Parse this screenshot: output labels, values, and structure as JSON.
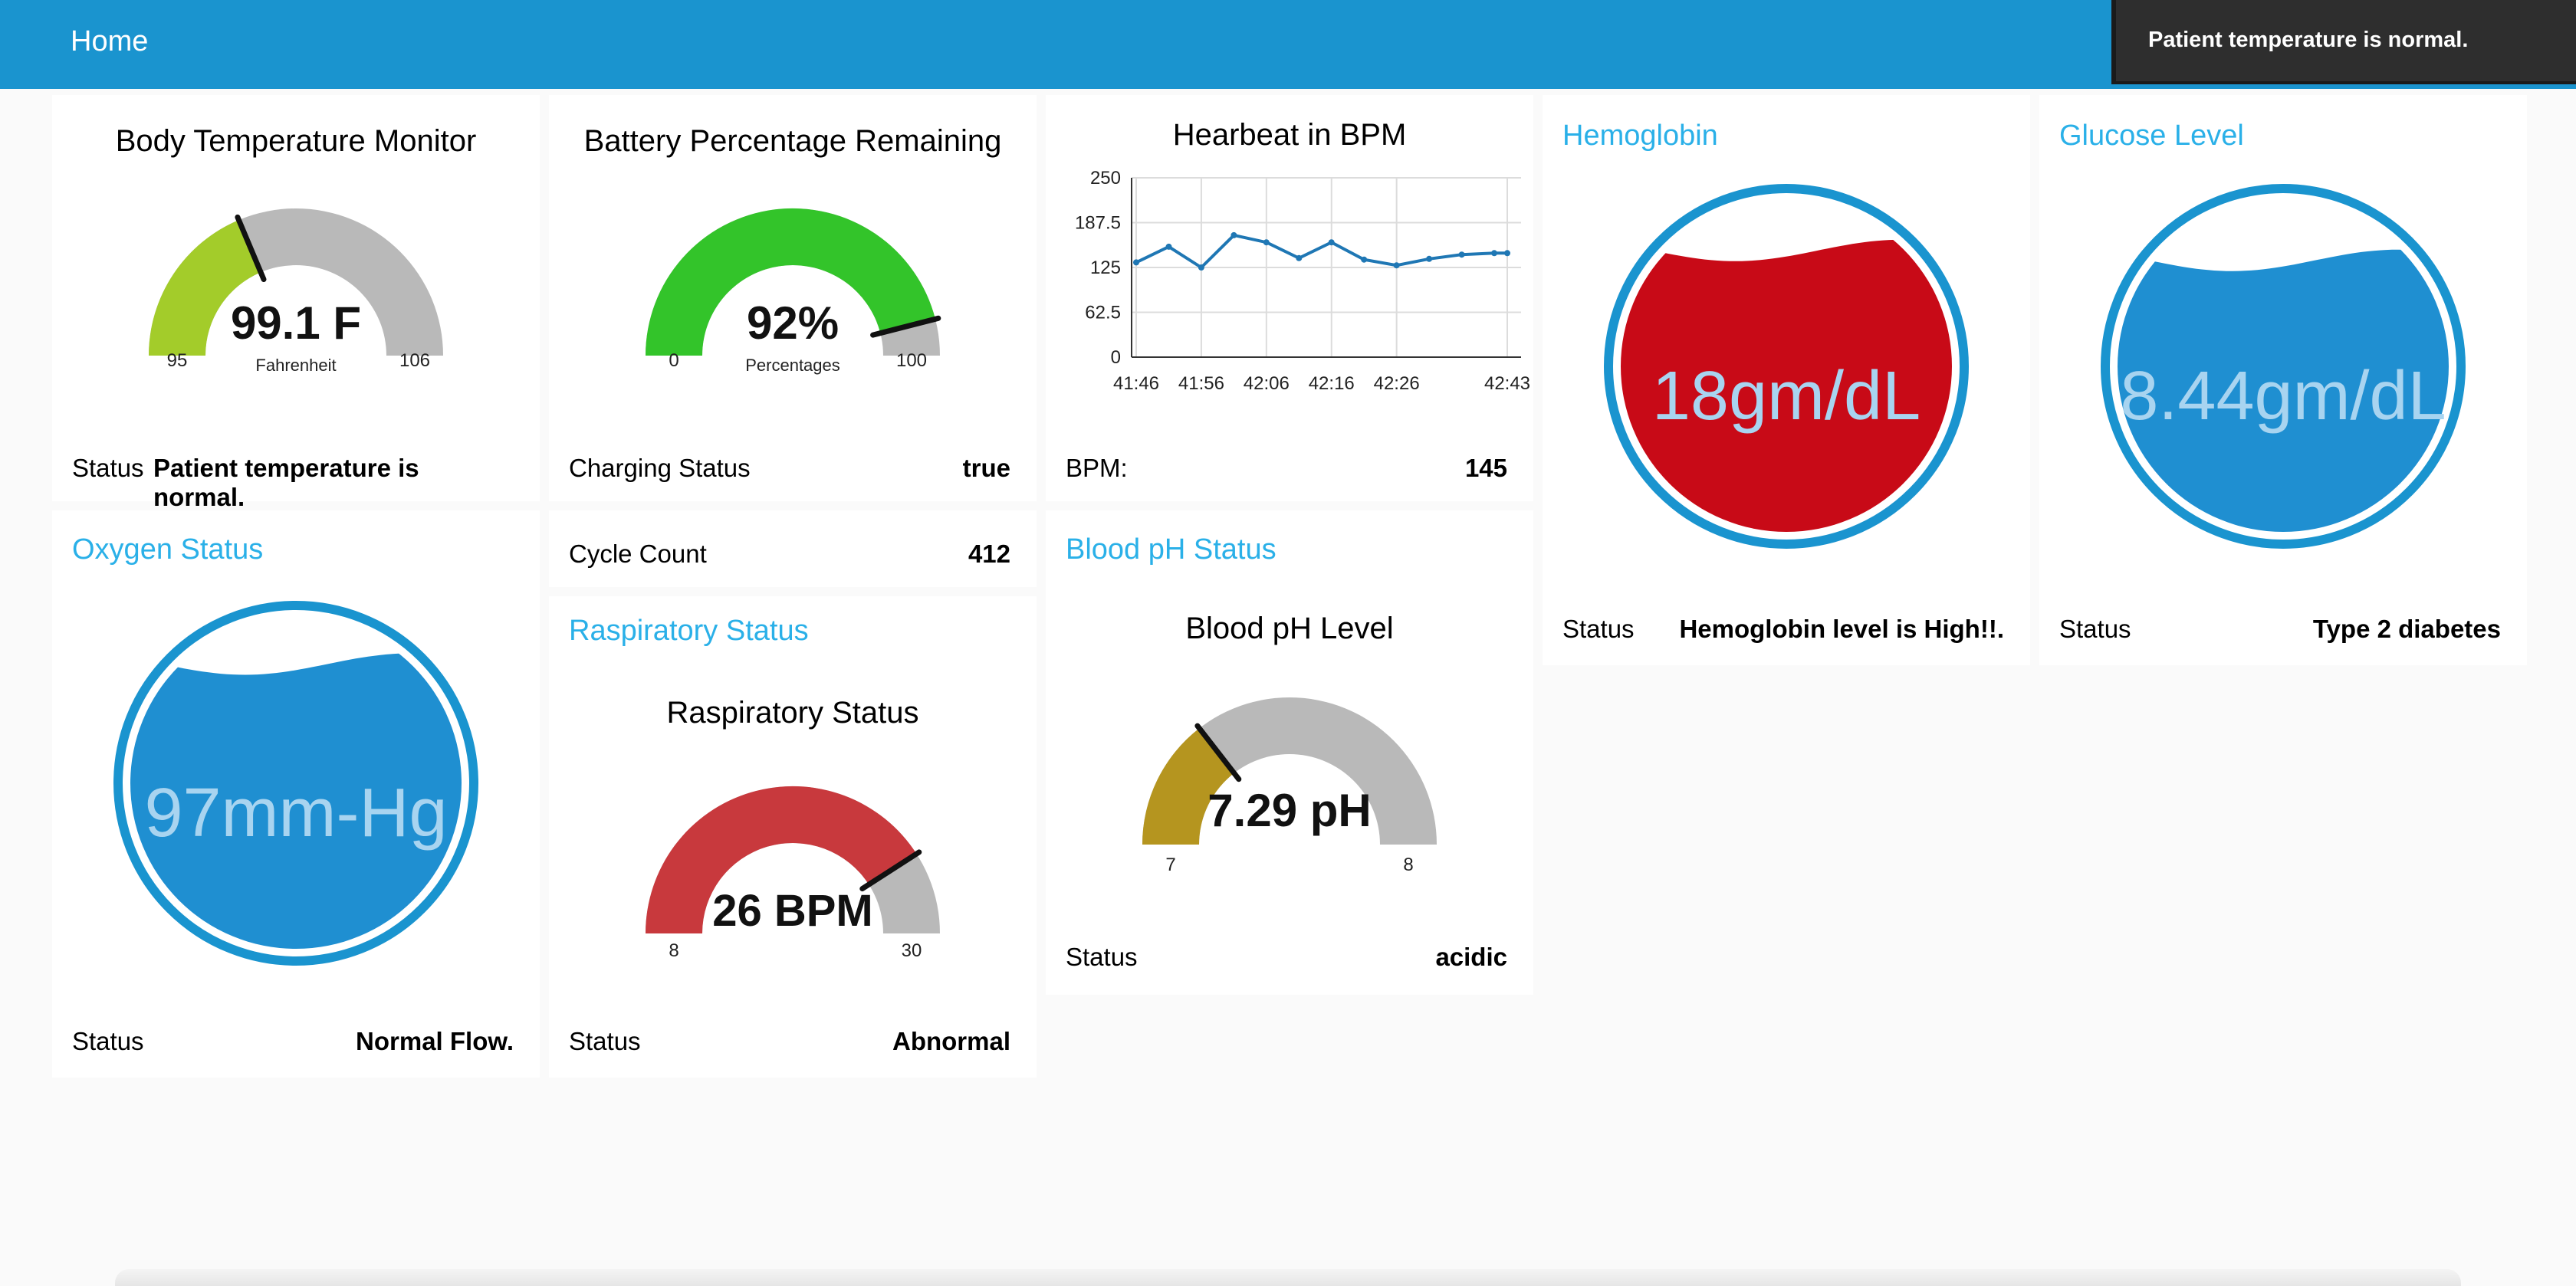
{
  "header": {
    "title": "Home"
  },
  "toast": {
    "message": "Patient temperature is normal."
  },
  "colors": {
    "header": "#1a94cf",
    "accent": "#2ab0e8",
    "gauge_track": "#b9b9b9",
    "temp_fill": "#a3cc2a",
    "battery_fill": "#33c42a",
    "resp_fill": "#c8393d",
    "ph_fill": "#b5951f",
    "hemoglobin_fill": "#c80a17",
    "liquid_blue": "#1f8fd1"
  },
  "temperature": {
    "title": "Body Temperature Monitor",
    "value": "99.1 F",
    "unit": "Fahrenheit",
    "min": "95",
    "max": "106",
    "level": 0.373,
    "status_label": "Status",
    "status_value": "Patient temperature is normal."
  },
  "battery": {
    "title": "Battery Percentage Remaining",
    "value": "92%",
    "unit": "Percentages",
    "min": "0",
    "max": "100",
    "level": 0.92,
    "charging_label": "Charging Status",
    "charging_value": "true",
    "cycle_label": "Cycle Count",
    "cycle_value": "412"
  },
  "heartbeat": {
    "title": "Hearbeat in BPM",
    "bpm_label": "BPM:",
    "bpm_value": "145"
  },
  "chart_data": {
    "type": "line",
    "title": "Hearbeat in BPM",
    "xlabel": "",
    "ylabel": "",
    "ylim": [
      0,
      250
    ],
    "yticks": [
      "250",
      "187.5",
      "125",
      "62.5",
      "0"
    ],
    "xticks": [
      "41:46",
      "41:56",
      "42:06",
      "42:16",
      "42:26",
      "42:43"
    ],
    "grid": true,
    "series": [
      {
        "x": [
          "41:46",
          "41:51",
          "41:56",
          "42:01",
          "42:06",
          "42:11",
          "42:16",
          "42:21",
          "42:26",
          "42:31",
          "42:36",
          "42:41",
          "42:43"
        ],
        "values": [
          132,
          154,
          125,
          170,
          160,
          138,
          160,
          136,
          128,
          137,
          143,
          145,
          145
        ]
      }
    ]
  },
  "hemoglobin": {
    "title": "Hemoglobin",
    "value": "18gm/dL",
    "level": 0.85,
    "status_label": "Status",
    "status_value": "Hemoglobin level is High!!."
  },
  "glucose": {
    "title": "Glucose Level",
    "value": "8.44gm/dL",
    "level": 0.82,
    "status_label": "Status",
    "status_value": "Type 2 diabetes"
  },
  "oxygen": {
    "title": "Oxygen Status",
    "value": "97mm-Hg",
    "level": 0.86,
    "status_label": "Status",
    "status_value": "Normal Flow."
  },
  "respiratory": {
    "title": "Raspiratory Status",
    "gauge_title": "Raspiratory Status",
    "value": "26 BPM",
    "min": "8",
    "max": "30",
    "level": 0.818,
    "status_label": "Status",
    "status_value": "Abnormal"
  },
  "blood_ph": {
    "title": "Blood pH Status",
    "gauge_title": "Blood pH Level",
    "value": "7.29 pH",
    "min": "7",
    "max": "8",
    "level": 0.29,
    "status_label": "Status",
    "status_value": "acidic"
  }
}
